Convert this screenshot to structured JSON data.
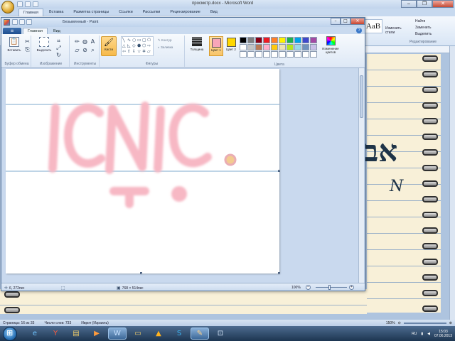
{
  "word": {
    "title": "просмотр.docx - Microsoft Word",
    "tabs": [
      "Главная",
      "Вставка",
      "Разметка страницы",
      "Ссылки",
      "Рассылки",
      "Рецензирование",
      "Вид"
    ],
    "ribbon": {
      "style_sample": "AaB",
      "change_styles": "Изменить стили",
      "find": "Найти",
      "replace": "Заменить",
      "select": "Выделить",
      "editing_group": "Редактирование"
    },
    "document": {
      "hebrew_print": "אב",
      "hebrew_script": "N"
    },
    "status": {
      "page": "Страница: 16 из 33",
      "words": "Число слов: 733",
      "language": "Иврит (Израиль)",
      "zoom": "150%"
    }
  },
  "paint": {
    "title": "Безымянный - Paint",
    "menu_button": "≡",
    "tabs": [
      "Главная",
      "Вид"
    ],
    "help": "?",
    "ribbon": {
      "paste_label": "Вставить",
      "select_label": "Выделить",
      "brush_label": "Кисти",
      "outline_label": "Контур",
      "fill_label": "Заливка",
      "size_label": "Толщина",
      "color1_label": "Цвет 1",
      "color2_label": "Цвет 2",
      "edit_colors_label": "Изменение цветов",
      "groups": {
        "clipboard": "Буфер обмена",
        "image": "Изображение",
        "tools": "Инструменты",
        "shapes": "Фигуры",
        "colors": "Цвета"
      },
      "color1": "#f7a6b8",
      "color2": "#ffd800",
      "palette": [
        "#000000",
        "#7f7f7f",
        "#880015",
        "#ed1c24",
        "#ff7f27",
        "#fff200",
        "#22b14c",
        "#00a2e8",
        "#3f48cc",
        "#a349a4",
        "#ffffff",
        "#c3c3c3",
        "#b97a57",
        "#ffaec9",
        "#ffc90e",
        "#efe4b0",
        "#b5e61d",
        "#99d9ea",
        "#7092be",
        "#c8bfe7",
        "#ffffff",
        "#ffffff",
        "#ffffff",
        "#ffffff",
        "#ffffff",
        "#ffffff",
        "#ffffff",
        "#ffffff",
        "#ffffff",
        "#ffffff"
      ]
    },
    "canvas": {
      "line_color": "#a9c6dd",
      "stroke_color": "#f7b8c4",
      "handwriting": "ICNIC"
    },
    "status": {
      "cursor_pos": "6, 272пкс",
      "canvas_size": "768 × 514пкс",
      "zoom": "100%"
    }
  },
  "taskbar": {
    "language": "RU",
    "time": "15:03",
    "date": "07.06.2013"
  }
}
